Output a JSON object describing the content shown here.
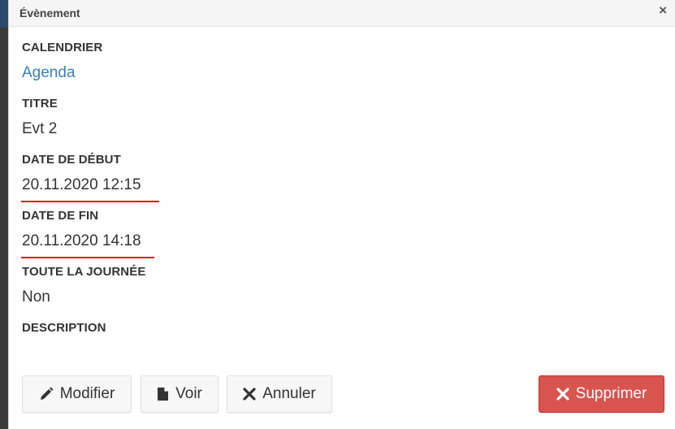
{
  "dialog": {
    "title": "Évènement",
    "close_glyph": "×"
  },
  "fields": {
    "calendar": {
      "label": "CALENDRIER",
      "value": "Agenda"
    },
    "title": {
      "label": "TITRE",
      "value": "Evt 2"
    },
    "start_date": {
      "label": "DATE DE DÉBUT",
      "value": "20.11.2020 12:15"
    },
    "end_date": {
      "label": "DATE DE FIN",
      "value": "20.11.2020 14:18"
    },
    "all_day": {
      "label": "TOUTE LA JOURNÉE",
      "value": "Non"
    },
    "description": {
      "label": "DESCRIPTION",
      "value": ""
    }
  },
  "buttons": {
    "edit": {
      "label": "Modifier",
      "icon": "pencil-icon"
    },
    "view": {
      "label": "Voir",
      "icon": "file-icon"
    },
    "cancel": {
      "label": "Annuler",
      "icon": "times-icon"
    },
    "delete": {
      "label": "Supprimer",
      "icon": "times-icon"
    }
  },
  "colors": {
    "link": "#3a80b8",
    "danger": "#d9534f",
    "annotation_underline": "#e11a1a"
  }
}
